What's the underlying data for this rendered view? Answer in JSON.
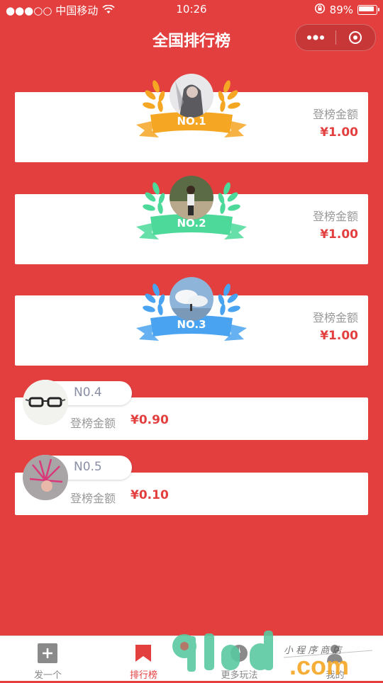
{
  "status_bar": {
    "carrier": "●●●○○ 中国移动",
    "time": "10:26",
    "battery": "89%"
  },
  "nav": {
    "title": "全国排行榜",
    "more_icon": "more-dots-icon",
    "close_icon": "target-circle-icon"
  },
  "top_ranks": [
    {
      "rank": "NO.1",
      "amount_label": "登榜金额",
      "amount": "¥1.00",
      "color": "#f5a623"
    },
    {
      "rank": "NO.2",
      "amount_label": "登榜金额",
      "amount": "¥1.00",
      "color": "#4cd99a"
    },
    {
      "rank": "NO.3",
      "amount_label": "登榜金额",
      "amount": "¥1.00",
      "color": "#4aa3f0"
    }
  ],
  "other_ranks": [
    {
      "rank": "N0.4",
      "amount_label": "登榜金额",
      "amount": "¥0.90"
    },
    {
      "rank": "N0.5",
      "amount_label": "登榜金额",
      "amount": "¥0.10"
    }
  ],
  "tabbar": {
    "items": [
      {
        "label": "发一个",
        "icon": "plus-square-icon"
      },
      {
        "label": "排行榜",
        "icon": "bookmark-icon"
      },
      {
        "label": "更多玩法",
        "icon": "grid-icon"
      },
      {
        "label": "我的",
        "icon": "user-icon"
      }
    ],
    "active_index": 1,
    "active_color": "#e33f3f"
  },
  "watermark": {
    "logo": "91cd.com",
    "tagline": "小程序商店"
  }
}
